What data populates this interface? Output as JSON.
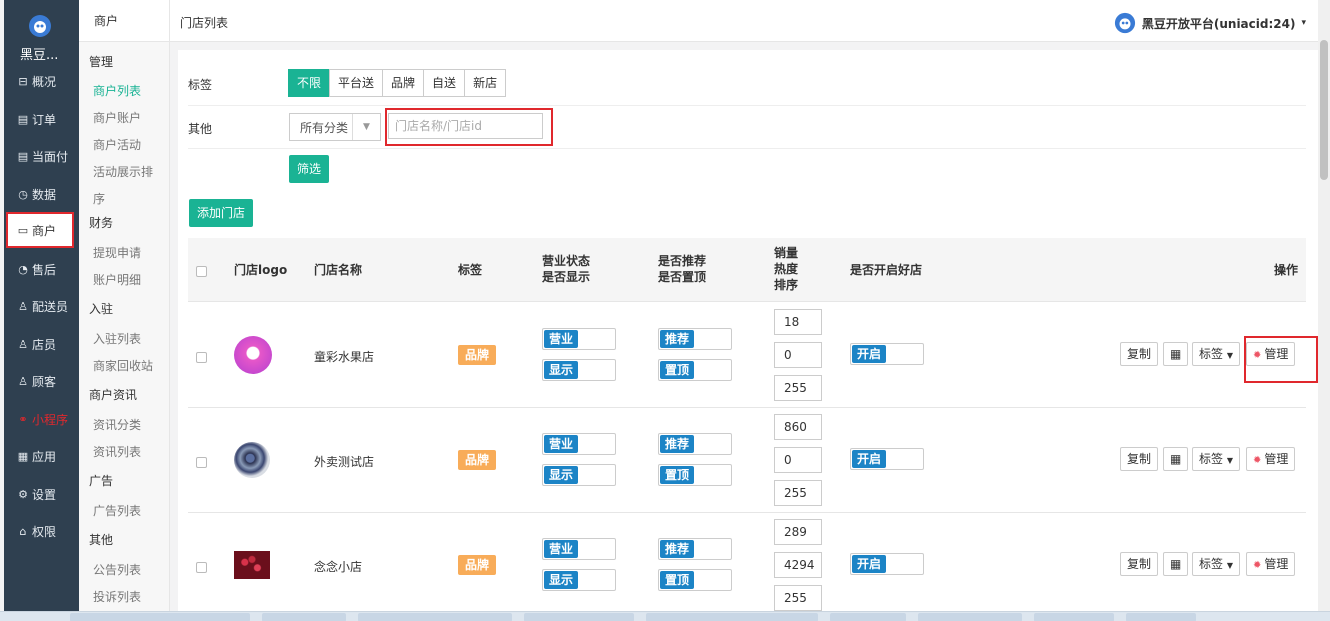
{
  "sidebar": {
    "brand": "黑豆...",
    "items": [
      {
        "label": "概况",
        "icon": "⊟"
      },
      {
        "label": "订单",
        "icon": "▤"
      },
      {
        "label": "当面付",
        "icon": "▤"
      },
      {
        "label": "数据",
        "icon": "◷"
      },
      {
        "label": "商户",
        "icon": "▭"
      },
      {
        "label": "售后",
        "icon": "◔"
      },
      {
        "label": "配送员",
        "icon": "♙"
      },
      {
        "label": "店员",
        "icon": "♙"
      },
      {
        "label": "顾客",
        "icon": "♙"
      },
      {
        "label": "小程序",
        "icon": "⚭"
      },
      {
        "label": "应用",
        "icon": "▦"
      },
      {
        "label": "设置",
        "icon": "⚙"
      },
      {
        "label": "权限",
        "icon": "⌂"
      }
    ]
  },
  "subnav": {
    "head": "商户",
    "groups": [
      "管理",
      "财务",
      "入驻",
      "商户资讯",
      "广告",
      "其他"
    ],
    "links": [
      "商户列表",
      "商户账户",
      "商户活动",
      "活动展示排",
      "序",
      "提现申请",
      "账户明细",
      "入驻列表",
      "商家回收站",
      "资讯分类",
      "资讯列表",
      "广告列表",
      "公告列表",
      "投诉列表"
    ]
  },
  "header": {
    "breadcrumb": "门店列表",
    "platform": "黑豆开放平台(uniacid:24)",
    "caret": "▾"
  },
  "filters": {
    "tag_label": "标签",
    "tags": [
      "不限",
      "平台送",
      "品牌",
      "自送",
      "新店"
    ],
    "other_label": "其他",
    "category": "所有分类",
    "search_placeholder": "门店名称/门店id",
    "filter_btn": "筛选",
    "add_btn": "添加门店"
  },
  "table": {
    "headers": {
      "logo": "门店logo",
      "name": "门店名称",
      "tag": "标签",
      "status1": "营业状态",
      "status2": "是否显示",
      "rec1": "是否推荐",
      "rec2": "是否置顶",
      "sales1": "销量",
      "sales2": "热度",
      "sales3": "排序",
      "good": "是否开启好店",
      "ops": "操作"
    },
    "toggles": {
      "business": "营业",
      "show": "显示",
      "recommend": "推荐",
      "top": "置顶",
      "good": "开启"
    },
    "actions": {
      "copy": "复制",
      "qr": "▦",
      "tag": "标签",
      "manage": "管理",
      "gear": "✹"
    },
    "rows": [
      {
        "name": "童彩水果店",
        "badge": "品牌",
        "sales": "18",
        "heat": "0",
        "sort": "255"
      },
      {
        "name": "外卖测试店",
        "badge": "品牌",
        "sales": "860",
        "heat": "0",
        "sort": "255"
      },
      {
        "name": "念念小店",
        "badge": "品牌",
        "sales": "289",
        "heat": "4294",
        "sort": "255"
      }
    ]
  },
  "colors": {
    "accent": "#1ab394",
    "sidebar": "#2f4050",
    "badge": "#f8ac59",
    "toggle": "#1c84c6",
    "highlight": "#e0282d"
  }
}
